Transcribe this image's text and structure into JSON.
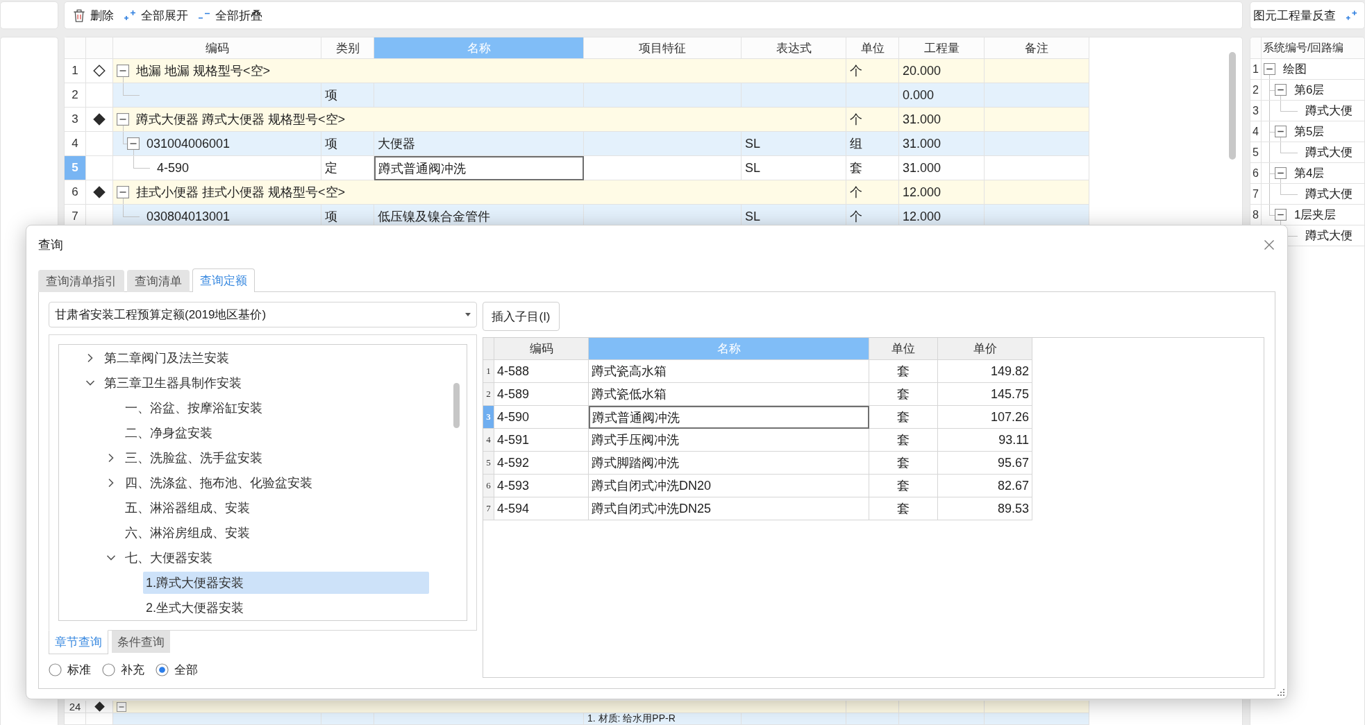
{
  "toolbar": {
    "buttons": [
      {
        "kind": "delete",
        "label": "删除"
      },
      {
        "kind": "expand_all",
        "label": "全部展开"
      },
      {
        "kind": "collapse_all",
        "label": "全部折叠"
      }
    ]
  },
  "table": {
    "columns": [
      {
        "label": "编码",
        "selected": false
      },
      {
        "label": "类别",
        "selected": false
      },
      {
        "label": "名称",
        "selected": true
      },
      {
        "label": "项目特征",
        "selected": false
      },
      {
        "label": "表达式",
        "selected": false
      },
      {
        "label": "单位",
        "selected": false
      },
      {
        "label": "工程量",
        "selected": false
      },
      {
        "label": "备注",
        "selected": false
      }
    ],
    "rows": [
      {
        "no": "1",
        "kind": "group",
        "filled": false,
        "expanded": true,
        "selected": false,
        "title": "地漏 地漏 规格型号<空>",
        "unit": "个",
        "quantity": "20.000",
        "children": [
          {
            "no": "2",
            "kind": "item",
            "selected": false,
            "category": "项",
            "quantity": "0.000"
          }
        ]
      },
      {
        "no": "3",
        "kind": "group",
        "filled": true,
        "expanded": true,
        "selected": false,
        "title": "蹲式大便器 蹲式大便器 规格型号<空>",
        "unit": "个",
        "quantity": "31.000",
        "children": [
          {
            "no": "4",
            "kind": "item",
            "expanded": true,
            "selected": false,
            "code": "031004006001",
            "category": "项",
            "name": "大便器",
            "expression": "SL",
            "unit": "组",
            "quantity": "31.000",
            "children": [
              {
                "no": "5",
                "kind": "quota",
                "selected": true,
                "code": "4-590",
                "category": "定",
                "name": "蹲式普通阀冲洗",
                "expression": "SL",
                "unit": "套",
                "quantity": "31.000"
              }
            ]
          }
        ]
      },
      {
        "no": "6",
        "kind": "group",
        "filled": true,
        "expanded": true,
        "selected": false,
        "title": "挂式小便器 挂式小便器 规格型号<空>",
        "unit": "个",
        "quantity": "12.000",
        "children": [
          {
            "no": "7",
            "kind": "item",
            "selected": false,
            "code": "030804013001",
            "category": "项",
            "name": "低压镍及镍合金管件",
            "expression": "SL",
            "unit": "个",
            "quantity": "12.000"
          }
        ]
      }
    ],
    "rows_below": [
      {
        "no": "24",
        "kind": "group",
        "filled": true,
        "expanded": true,
        "selected": false,
        "children": [
          {
            "kind": "item",
            "selected": false,
            "feature": "1. 材质: 给水用PP-R"
          }
        ]
      }
    ]
  },
  "side_panel": {
    "title": "图元工程量反查",
    "column": "系统编号/回路编",
    "rows": [
      {
        "no": "1",
        "label": "绘图",
        "expanded": true,
        "children": [
          {
            "no": "2",
            "label": "第6层",
            "expanded": true,
            "children": [
              {
                "no": "3",
                "label": "蹲式大便"
              }
            ]
          },
          {
            "no": "4",
            "label": "第5层",
            "expanded": true,
            "children": [
              {
                "no": "5",
                "label": "蹲式大便"
              }
            ]
          },
          {
            "no": "6",
            "label": "第4层",
            "expanded": true,
            "children": [
              {
                "no": "7",
                "label": "蹲式大便"
              }
            ]
          },
          {
            "no": "8",
            "label": "1层夹层",
            "expanded": true,
            "children": [
              {
                "label": "蹲式大便"
              }
            ]
          }
        ]
      }
    ]
  },
  "dialog": {
    "title": "查询",
    "tabs": [
      {
        "label": "查询清单指引",
        "selected": false
      },
      {
        "label": "查询清单",
        "selected": false
      },
      {
        "label": "查询定额",
        "selected": true
      }
    ],
    "library": {
      "value": "甘肃省安装工程预算定额(2019地区基价)"
    },
    "chapter_tree": [
      {
        "label": "第二章阀门及法兰安装",
        "expanded": false,
        "selected": false
      },
      {
        "label": "第三章卫生器具制作安装",
        "expanded": true,
        "selected": false,
        "children": [
          {
            "label": "一、浴盆、按摩浴缸安装",
            "selected": false
          },
          {
            "label": "二、净身盆安装",
            "selected": false
          },
          {
            "label": "三、洗脸盆、洗手盆安装",
            "expanded": false,
            "selected": false
          },
          {
            "label": "四、洗涤盆、拖布池、化验盆安装",
            "expanded": false,
            "selected": false
          },
          {
            "label": "五、淋浴器组成、安装",
            "selected": false
          },
          {
            "label": "六、淋浴房组成、安装",
            "selected": false
          },
          {
            "label": "七、大便器安装",
            "expanded": true,
            "selected": false,
            "children": [
              {
                "label": "1.蹲式大便器安装",
                "selected": true
              },
              {
                "label": "2.坐式大便器安装",
                "selected": false
              }
            ]
          }
        ]
      }
    ],
    "bottom_tabs": [
      {
        "label": "章节查询",
        "selected": true
      },
      {
        "label": "条件查询",
        "selected": false
      }
    ],
    "filters": [
      {
        "label": "标准",
        "selected": false
      },
      {
        "label": "补充",
        "selected": false
      },
      {
        "label": "全部",
        "selected": true
      }
    ],
    "insert_button": "插入子目(I)",
    "results": {
      "columns": [
        {
          "label": "编码",
          "selected": false
        },
        {
          "label": "名称",
          "selected": true
        },
        {
          "label": "单位",
          "selected": false
        },
        {
          "label": "单价",
          "selected": false
        }
      ],
      "rows": [
        {
          "no": "1",
          "code": "4-588",
          "name": "蹲式瓷高水箱",
          "unit": "套",
          "price": "149.82",
          "selected": false
        },
        {
          "no": "2",
          "code": "4-589",
          "name": "蹲式瓷低水箱",
          "unit": "套",
          "price": "145.75",
          "selected": false
        },
        {
          "no": "3",
          "code": "4-590",
          "name": "蹲式普通阀冲洗",
          "unit": "套",
          "price": "107.26",
          "selected": true
        },
        {
          "no": "4",
          "code": "4-591",
          "name": "蹲式手压阀冲洗",
          "unit": "套",
          "price": "93.11",
          "selected": false
        },
        {
          "no": "5",
          "code": "4-592",
          "name": "蹲式脚踏阀冲洗",
          "unit": "套",
          "price": "95.67",
          "selected": false
        },
        {
          "no": "6",
          "code": "4-593",
          "name": "蹲式自闭式冲洗DN20",
          "unit": "套",
          "price": "82.67",
          "selected": false
        },
        {
          "no": "7",
          "code": "4-594",
          "name": "蹲式自闭式冲洗DN25",
          "unit": "套",
          "price": "89.53",
          "selected": false
        }
      ]
    }
  }
}
